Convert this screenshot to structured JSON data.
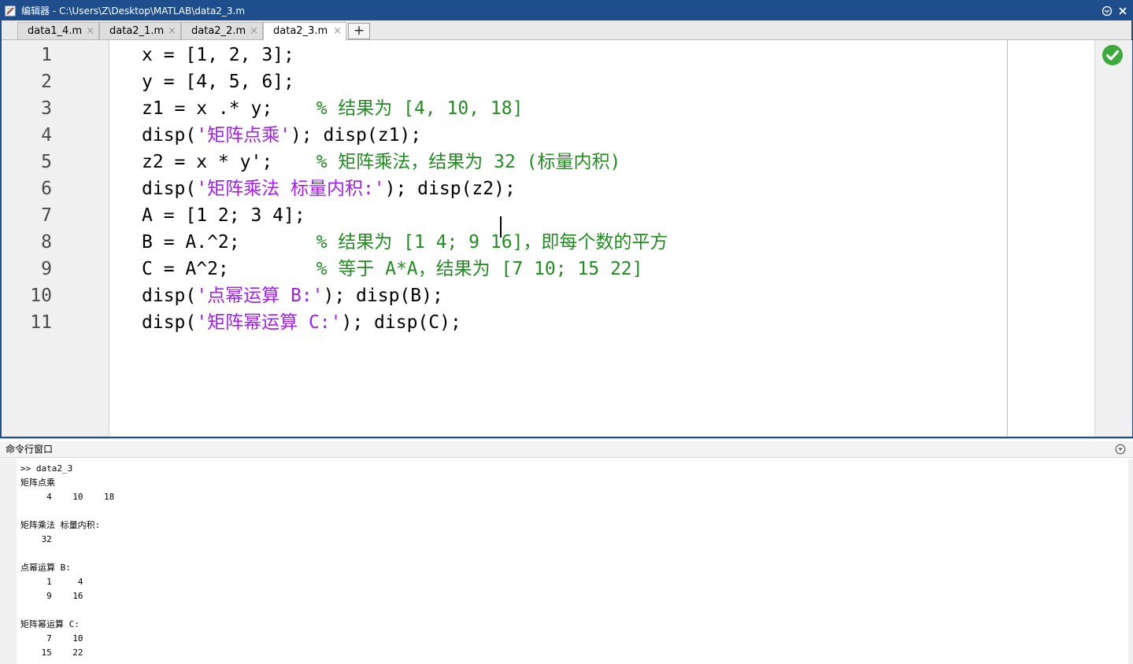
{
  "editor": {
    "title": "编辑器 - C:\\Users\\Z\\Desktop\\MATLAB\\data2_3.m",
    "tabs": [
      {
        "label": "data1_4.m",
        "close": "×"
      },
      {
        "label": "data2_1.m",
        "close": "×"
      },
      {
        "label": "data2_2.m",
        "close": "×"
      },
      {
        "label": "data2_3.m",
        "close": "×",
        "active": true
      }
    ],
    "add_tab_label": "+",
    "line_numbers": [
      "1",
      "2",
      "3",
      "4",
      "5",
      "6",
      "7",
      "8",
      "9",
      "10",
      "11"
    ],
    "code": [
      [
        {
          "text": "x = [1, 2, 3];",
          "type": "code"
        }
      ],
      [
        {
          "text": "y = [4, 5, 6];",
          "type": "code"
        }
      ],
      [
        {
          "text": "z1 = x .* y;    ",
          "type": "code"
        },
        {
          "text": "% 结果为 [4, 10, 18]",
          "type": "comment"
        }
      ],
      [
        {
          "text": "disp(",
          "type": "code"
        },
        {
          "text": "'矩阵点乘'",
          "type": "string"
        },
        {
          "text": "); disp(z1);",
          "type": "code"
        }
      ],
      [
        {
          "text": "z2 = x * y';    ",
          "type": "code"
        },
        {
          "text": "% 矩阵乘法，结果为 32 (标量内积)",
          "type": "comment"
        }
      ],
      [
        {
          "text": "disp(",
          "type": "code"
        },
        {
          "text": "'矩阵乘法 标量内积:'",
          "type": "string"
        },
        {
          "text": "); disp(z2);",
          "type": "code"
        }
      ],
      [
        {
          "text": "A = [1 2; 3 4];",
          "type": "code"
        }
      ],
      [
        {
          "text": "B = A.^2;       ",
          "type": "code"
        },
        {
          "text": "% 结果为 [1 4; 9 16]，即每个数的平方",
          "type": "comment"
        }
      ],
      [
        {
          "text": "C = A^2;        ",
          "type": "code"
        },
        {
          "text": "% 等于 A*A，结果为 [7 10; 15 22]",
          "type": "comment"
        }
      ],
      [
        {
          "text": "disp(",
          "type": "code"
        },
        {
          "text": "'点幂运算 B:'",
          "type": "string"
        },
        {
          "text": "); disp(B);",
          "type": "code"
        }
      ],
      [
        {
          "text": "disp(",
          "type": "code"
        },
        {
          "text": "'矩阵幂运算 C:'",
          "type": "string"
        },
        {
          "text": "); disp(C);",
          "type": "code"
        }
      ]
    ],
    "status_icon": "check-circle-icon",
    "status_color": "#3cab3c"
  },
  "command_window": {
    "title": "命令行窗口",
    "lines": [
      ">> data2_3",
      "矩阵点乘",
      "     4    10    18",
      "",
      "矩阵乘法 标量内积:",
      "    32",
      "",
      "点幂运算 B:",
      "     1     4",
      "     9    16",
      "",
      "矩阵幂运算 C:",
      "     7    10",
      "    15    22"
    ]
  },
  "colors": {
    "frame": "#1f4e8c",
    "string": "#a020f0",
    "comment": "#228b22",
    "gutter": "#f0f0f0"
  }
}
